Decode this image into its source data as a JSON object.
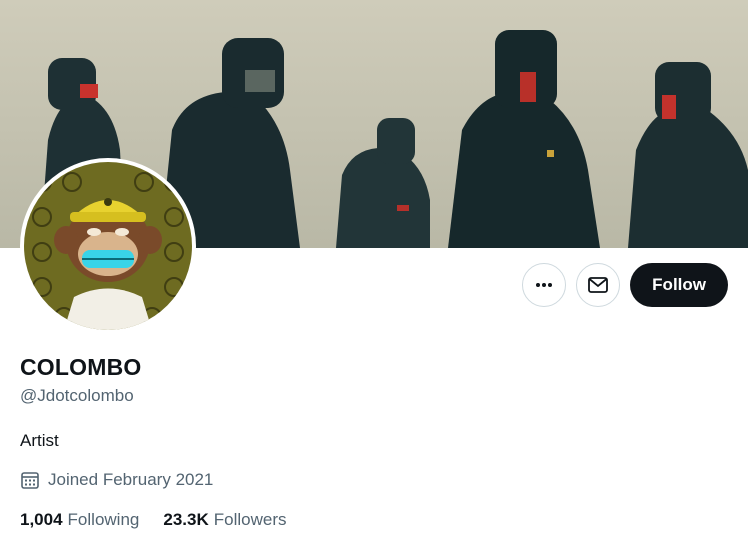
{
  "profile": {
    "name": "COLOMBO",
    "handle": "@Jdotcolombo",
    "bio": "Artist",
    "joined": "Joined February 2021",
    "following_count": "1,004",
    "following_label": "Following",
    "followers_count": "23.3K",
    "followers_label": "Followers"
  },
  "actions": {
    "follow_label": "Follow",
    "more_icon": "more-horizontal-icon",
    "message_icon": "envelope-icon"
  },
  "icons": {
    "joined": "calendar-icon"
  },
  "colors": {
    "text_primary": "#0f1419",
    "text_secondary": "#536471",
    "follow_bg": "#0f1419",
    "border": "#cfd9de"
  }
}
